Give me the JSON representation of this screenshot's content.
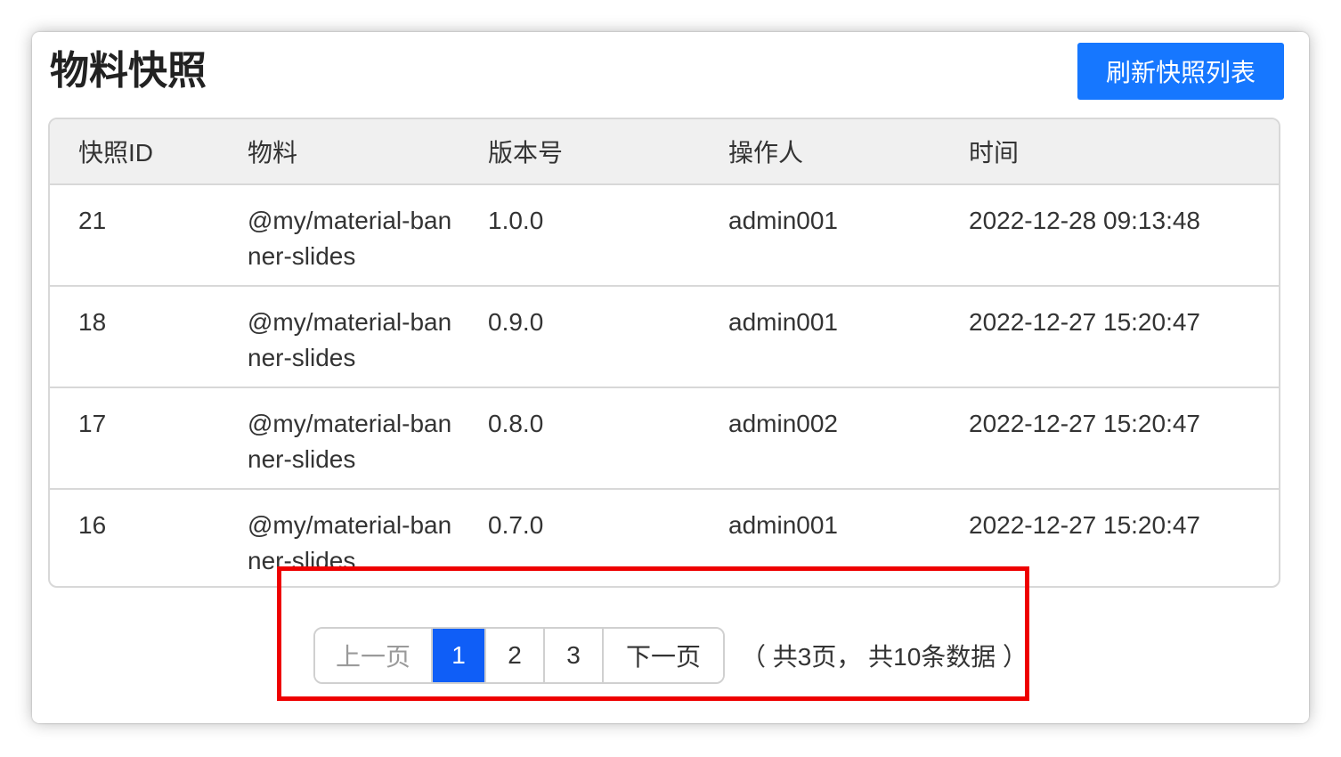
{
  "page": {
    "title": "物料快照",
    "refresh_label": "刷新快照列表"
  },
  "table": {
    "headers": [
      "快照ID",
      "物料",
      "版本号",
      "操作人",
      "时间"
    ],
    "rows": [
      [
        "21",
        "@my/material-banner-slides",
        "1.0.0",
        "admin001",
        "2022-12-28 09:13:48"
      ],
      [
        "18",
        "@my/material-banner-slides",
        "0.9.0",
        "admin001",
        "2022-12-27 15:20:47"
      ],
      [
        "17",
        "@my/material-banner-slides",
        "0.8.0",
        "admin002",
        "2022-12-27 15:20:47"
      ],
      [
        "16",
        "@my/material-banner-slides",
        "0.7.0",
        "admin001",
        "2022-12-27 15:20:47"
      ]
    ]
  },
  "pagination": {
    "prev_label": "上一页",
    "pages": [
      "1",
      "2",
      "3"
    ],
    "current_page": "1",
    "next_label": "下一页",
    "summary": "（ 共3页， 共10条数据 ）"
  },
  "colors": {
    "accent": "#1677ff",
    "active_page": "#0f5ef7",
    "highlight": "#ee0000"
  }
}
